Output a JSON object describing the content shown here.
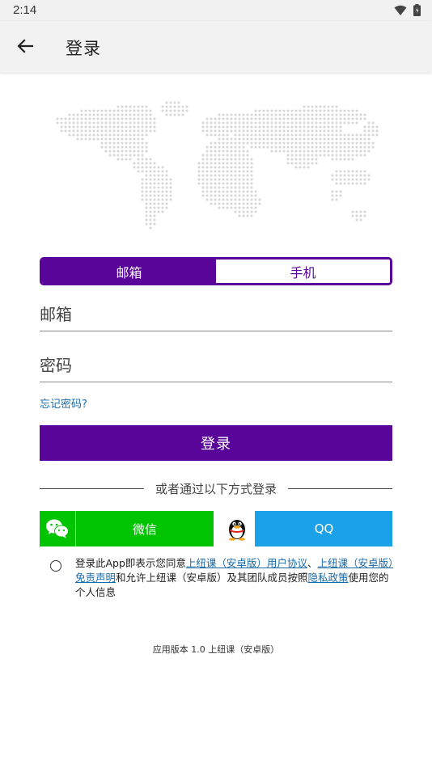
{
  "status_bar": {
    "time": "2:14"
  },
  "app_bar": {
    "title": "登录",
    "back_icon": "arrow-left-icon"
  },
  "tabs": [
    {
      "label": "邮箱",
      "active": true
    },
    {
      "label": "手机",
      "active": false
    }
  ],
  "form": {
    "email_placeholder": "邮箱",
    "email_value": "",
    "password_placeholder": "密码",
    "password_value": "",
    "forgot_label": "忘记密码?",
    "login_label": "登录"
  },
  "divider_text": "或者通过以下方式登录",
  "social": {
    "wechat_label": "微信",
    "qq_label": "QQ"
  },
  "agreement": {
    "part1": "登录此App即表示您同意",
    "link1": "上纽课（安卓版）用户协议",
    "sep1": "、",
    "link2": "上纽课（安卓版）免责声明",
    "part2": "和允许上纽课（安卓版）及其团队成员按照",
    "link3": "隐私政策",
    "part3": "使用您的个人信息"
  },
  "version": "应用版本 1.0 上纽课（安卓版）",
  "colors": {
    "accent": "#5a0599",
    "wechat": "#00c400",
    "qq": "#1aa1e8",
    "link": "#1a6aa8"
  }
}
